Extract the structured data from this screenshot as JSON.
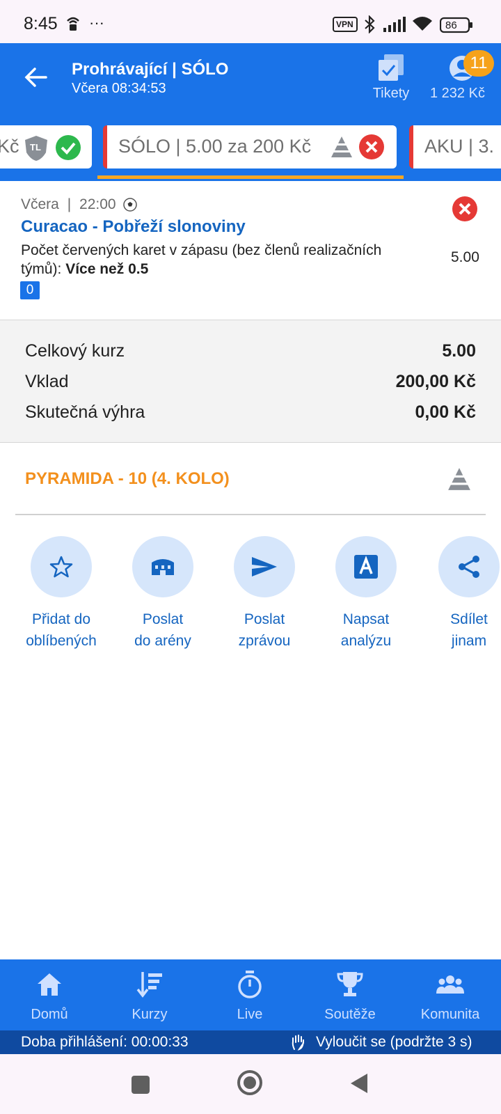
{
  "status_bar": {
    "time": "8:45",
    "more": "···",
    "vpn": "VPN",
    "battery": "86"
  },
  "header": {
    "title": "Prohrávající | SÓLO",
    "subtitle": "Včera 08:34:53",
    "tickets_label": "Tikety",
    "balance": "1 232 Kč",
    "notifications_count": "11"
  },
  "ticket_tabs": [
    {
      "label": "Kč",
      "status": "won",
      "badge": "TL"
    },
    {
      "label": "SÓLO  |  5.00 za 200 Kč",
      "status": "lost",
      "active": true
    },
    {
      "label": "AKU  |  3."
    }
  ],
  "bet": {
    "date": "Včera",
    "time": "22:00",
    "sport_icon": "soccer-ball-icon",
    "match": "Curacao - Pobřeží slonoviny",
    "market": "Počet červených karet v zápasu (bez členů realizačních týmů):",
    "selection": "Více než 0.5",
    "odds": "5.00",
    "score_badge": "0",
    "result_icon": "cross-icon"
  },
  "summary": {
    "total_odds_label": "Celkový kurz",
    "total_odds_value": "5.00",
    "stake_label": "Vklad",
    "stake_value": "200,00 Kč",
    "win_label": "Skutečná výhra",
    "win_value": "0,00 Kč"
  },
  "pyramid": {
    "label": "PYRAMIDA - 10 (4. KOLO)"
  },
  "actions": [
    {
      "line1": "Přidat do",
      "line2": "oblíbených",
      "icon": "star-icon"
    },
    {
      "line1": "Poslat",
      "line2": "do arény",
      "icon": "arena-icon"
    },
    {
      "line1": "Poslat",
      "line2": "zprávou",
      "icon": "send-icon"
    },
    {
      "line1": "Napsat",
      "line2": "analýzu",
      "icon": "analysis-icon"
    },
    {
      "line1": "Sdílet",
      "line2": "jinam",
      "icon": "share-icon"
    }
  ],
  "bottom_nav": [
    {
      "label": "Domů",
      "icon": "home-icon"
    },
    {
      "label": "Kurzy",
      "icon": "odds-icon"
    },
    {
      "label": "Live",
      "icon": "stopwatch-icon"
    },
    {
      "label": "Soutěže",
      "icon": "trophy-icon"
    },
    {
      "label": "Komunita",
      "icon": "community-icon"
    }
  ],
  "session": {
    "login_time": "Doba přihlášení: 00:00:33",
    "exclude": "Vyloučit se (podržte 3 s)"
  },
  "colors": {
    "brand_blue": "#1a73e8",
    "accent_orange": "#f5a623",
    "lost_red": "#e53935",
    "won_green": "#2db84d"
  }
}
